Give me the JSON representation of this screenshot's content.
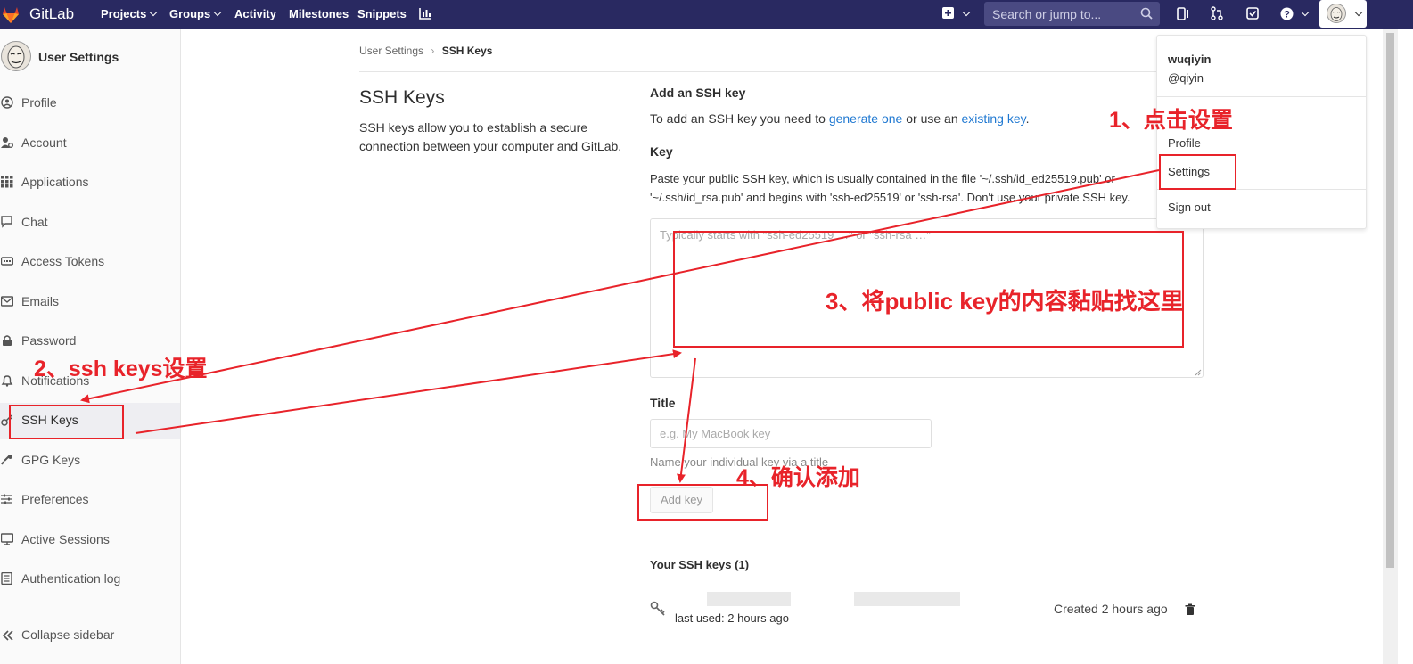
{
  "topbar": {
    "brand": "GitLab",
    "nav": [
      "Projects",
      "Groups",
      "Activity",
      "Milestones",
      "Snippets"
    ],
    "search_placeholder": "Search or jump to..."
  },
  "sidebar": {
    "title": "User Settings",
    "items": [
      {
        "label": "Profile",
        "icon": "user-circle-icon"
      },
      {
        "label": "Account",
        "icon": "user-cog-icon"
      },
      {
        "label": "Applications",
        "icon": "grid-icon"
      },
      {
        "label": "Chat",
        "icon": "chat-bubble-icon"
      },
      {
        "label": "Access Tokens",
        "icon": "token-icon"
      },
      {
        "label": "Emails",
        "icon": "envelope-icon"
      },
      {
        "label": "Password",
        "icon": "lock-icon"
      },
      {
        "label": "Notifications",
        "icon": "bell-icon"
      },
      {
        "label": "SSH Keys",
        "icon": "key-icon"
      },
      {
        "label": "GPG Keys",
        "icon": "key-icon"
      },
      {
        "label": "Preferences",
        "icon": "sliders-icon"
      },
      {
        "label": "Active Sessions",
        "icon": "monitor-icon"
      },
      {
        "label": "Authentication log",
        "icon": "log-icon"
      }
    ],
    "collapse_label": "Collapse sidebar"
  },
  "breadcrumb": {
    "parent": "User Settings",
    "current": "SSH Keys"
  },
  "main": {
    "title": "SSH Keys",
    "description": "SSH keys allow you to establish a secure connection between your computer and GitLab.",
    "add_heading": "Add an SSH key",
    "add_text_1": "To add an SSH key you need to ",
    "generate_link": "generate one",
    "add_text_2": " or use an ",
    "existing_link": "existing key",
    "add_text_3": ".",
    "key_label": "Key",
    "key_help": "Paste your public SSH key, which is usually contained in the file '~/.ssh/id_ed25519.pub' or '~/.ssh/id_rsa.pub' and begins with 'ssh-ed25519' or 'ssh-rsa'. Don't use your private SSH key.",
    "key_placeholder": "Typically starts with \"ssh-ed25519 …\" or \"ssh-rsa …\"",
    "title_label": "Title",
    "title_placeholder": "e.g. My MacBook key",
    "title_hint": "Name your individual key via a title",
    "add_button": "Add key",
    "your_keys": "Your SSH keys (1)",
    "last_used": "last used: 2 hours ago",
    "created": "Created 2 hours ago"
  },
  "dropdown": {
    "name": "wuqiyin",
    "username": "@qiyin",
    "items": [
      "Profile",
      "Settings",
      "Sign out"
    ]
  },
  "annotations": {
    "step1": "1、点击设置",
    "step2": "2、ssh keys设置",
    "step3": "3、将public key的内容黏贴找这里",
    "step4": "4、确认添加"
  },
  "colors": {
    "topbar": "#292961",
    "annotation": "#e8232a",
    "link": "#1f78d1"
  }
}
